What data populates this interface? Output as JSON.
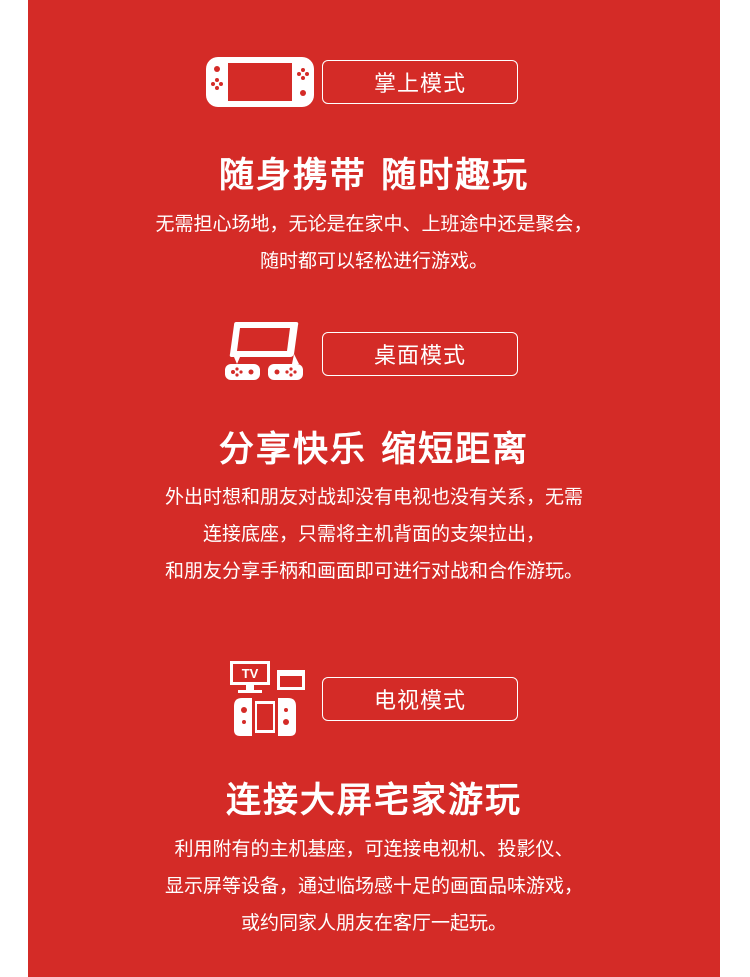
{
  "colors": {
    "panel_red": "#d42b27",
    "text": "#ffffff"
  },
  "sections": [
    {
      "icon": "handheld-console-icon",
      "mode_label": "掌上模式",
      "headline": "随身携带 随时趣玩",
      "description": [
        "无需担心场地，无论是在家中、上班途中还是聚会，",
        "随时都可以轻松进行游戏。"
      ]
    },
    {
      "icon": "tabletop-stand-icon",
      "mode_label": "桌面模式",
      "headline": "分享快乐 缩短距离",
      "description": [
        "外出时想和朋友对战却没有电视也没有关系，无需",
        "连接底座，只需将主机背面的支架拉出，",
        "和朋友分享手柄和画面即可进行对战和合作游玩。"
      ]
    },
    {
      "icon": "tv-dock-icon",
      "tv_label": "TV",
      "mode_label": "电视模式",
      "headline": "连接大屏宅家游玩",
      "description": [
        "利用附有的主机基座，可连接电视机、投影仪、",
        "显示屏等设备，通过临场感十足的画面品味游戏，",
        "或约同家人朋友在客厅一起玩。"
      ]
    }
  ]
}
